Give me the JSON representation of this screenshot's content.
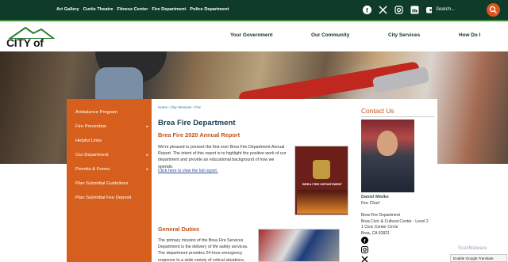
{
  "utility_bar": {
    "links": [
      "Art Gallery",
      "Curtis Theatre",
      "Fitness Center",
      "Fire Department",
      "Police Department"
    ],
    "search_placeholder": "Search..."
  },
  "logo": {
    "text": "CITY of BREA"
  },
  "nav": {
    "items": [
      "Your Government",
      "Our Community",
      "City Services",
      "How Do I"
    ]
  },
  "sidebar": {
    "items": [
      {
        "label": "Ambulance Program",
        "has_submenu": false
      },
      {
        "label": "Fire Prevention",
        "has_submenu": true
      },
      {
        "label": "Helpful Links",
        "has_submenu": false
      },
      {
        "label": "Our Department",
        "has_submenu": true
      },
      {
        "label": "Permits & Forms",
        "has_submenu": true
      },
      {
        "label": "Plan Submittal Guidelines",
        "has_submenu": false
      },
      {
        "label": "Plan Submittal Fee Deposit",
        "has_submenu": false
      }
    ]
  },
  "main": {
    "breadcrumb": "Home › City Services › Fire",
    "title": "Brea Fire Department",
    "section1_heading": "Brea Fire 2020 Annual Report",
    "section1_text": "We're pleased to present the first ever Brea Fire Department Annual Report. The intent of this report is to highlight the positive work of our department and provide an educational background of how we operate.",
    "report_link": "Click here to view the full report.",
    "report_cover_caption": "BREA FIRE DEPARTMENT",
    "section2_heading": "General Duties",
    "section2_text": "The primary mission of the Brea Fire Services Department is the delivery of life safety services. The department provides 24-hour emergency response to a wide variety of critical situations,"
  },
  "contact": {
    "title": "Contact Us",
    "name": "Daniel Mielke",
    "role": "Fire Chief",
    "address_lines": [
      "Brea Fire Department",
      "Brea Civic & Cultural Center - Level 2",
      "1 Civic Center Circle",
      "Brea, CA 92821"
    ]
  },
  "overlays": {
    "scan": "ScanMalware",
    "translate": "Enable Google Translate"
  },
  "colors": {
    "topbar": "#0f3b2a",
    "accent_orange": "#d65f1d",
    "heading_blue": "#163a52"
  }
}
